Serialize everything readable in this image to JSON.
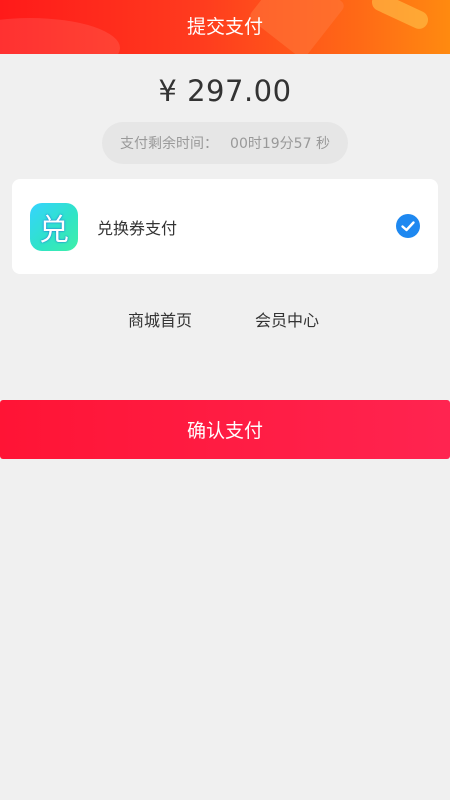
{
  "header": {
    "title": "提交支付"
  },
  "order": {
    "amount": "¥ 297.00"
  },
  "countdown": {
    "label": "支付剩余时间：",
    "value": "00时19分57 秒"
  },
  "payment": {
    "icon_glyph": "兑",
    "method_label": "兑换券支付",
    "selected": true
  },
  "links": {
    "mall_home": "商城首页",
    "member_center": "会员中心"
  },
  "confirm": {
    "label": "确认支付"
  },
  "colors": {
    "header_start": "#ff1a1a",
    "header_end": "#ff8a10",
    "check": "#1e88f0",
    "confirm": "#ff1435",
    "icon_start": "#36d3ff",
    "icon_end": "#3ff0a8"
  }
}
